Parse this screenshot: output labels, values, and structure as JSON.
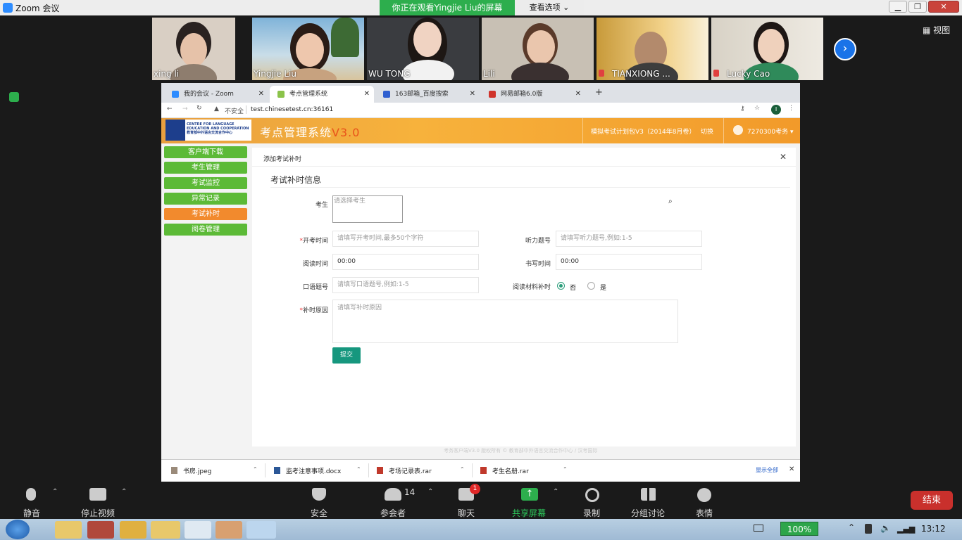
{
  "zoom": {
    "window_title": "Zoom 会议",
    "share_banner": "你正在观看Yingjie  Liu的屏幕",
    "view_options": "查看选项",
    "view_toggle": "视图",
    "participants": [
      {
        "name": "xing li",
        "muted": false
      },
      {
        "name": "Yingjie Liu",
        "muted": false
      },
      {
        "name": "WU TONG",
        "muted": false
      },
      {
        "name": "Lili",
        "muted": false
      },
      {
        "name": "TIANXIONG ...",
        "muted": true
      },
      {
        "name": "Lucky Cao",
        "muted": true
      }
    ],
    "toolbar": {
      "mute": "静音",
      "stop_video": "停止视频",
      "security": "安全",
      "participants": "参会者",
      "participants_count": "14",
      "chat": "聊天",
      "chat_badge": "1",
      "share_screen": "共享屏幕",
      "record": "录制",
      "breakout": "分组讨论",
      "reactions": "表情",
      "end": "结束"
    }
  },
  "browser": {
    "tabs": [
      {
        "title": "我的会议 - Zoom",
        "active": false
      },
      {
        "title": "考点管理系统",
        "active": true
      },
      {
        "title": "163邮箱_百度搜索",
        "active": false
      },
      {
        "title": "网易邮箱6.0版",
        "active": false
      }
    ],
    "new_tab": "+",
    "security_label": "不安全",
    "url": "test.chinesetest.cn:36161",
    "profile_initial": "I"
  },
  "site": {
    "logo_text": "CENTRE FOR LANGUAGE EDUCATION AND COOPERATION 教育部中外语言交流合作中心",
    "title": "考点管理系统",
    "version": "V3.0",
    "plan": "模拟考试计划包V3（2014年8月卷）",
    "switch": "切换",
    "user": "7270300考务",
    "nav": [
      {
        "label": "客户端下载",
        "active": false
      },
      {
        "label": "考生管理",
        "active": false
      },
      {
        "label": "考试监控",
        "active": false
      },
      {
        "label": "异常记录",
        "active": false
      },
      {
        "label": "考试补时",
        "active": true
      },
      {
        "label": "阅卷管理",
        "active": false
      }
    ],
    "footer": "考务客户端V3.0 版权所有 © 教育部中外语言交流合作中心 / 汉考国际"
  },
  "form": {
    "dialog_title": "添加考试补时",
    "section_title": "考试补时信息",
    "fields": {
      "candidate": {
        "label": "考生",
        "placeholder": "请选择考生"
      },
      "start_time": {
        "label": "开考时间",
        "placeholder": "请填写开考时间,最多50个字符"
      },
      "listening_no": {
        "label": "听力题号",
        "placeholder": "请填写听力题号,例如:1-5"
      },
      "reading_time": {
        "label": "阅读时间",
        "value": "00:00"
      },
      "writing_time": {
        "label": "书写时间",
        "value": "00:00"
      },
      "speaking_no": {
        "label": "口语题号",
        "placeholder": "请填写口语题号,例如:1-5"
      },
      "reading_material": {
        "label": "阅读材料补时",
        "options": [
          "否",
          "是"
        ],
        "selected": "否"
      },
      "reason": {
        "label": "补时原因",
        "placeholder": "请填写补时原因"
      }
    },
    "submit": "提交"
  },
  "downloads": {
    "items": [
      "书房.jpeg",
      "监考注意事项.docx",
      "考场记录表.rar",
      "考生名册.rar"
    ],
    "show_all": "显示全部"
  },
  "taskbar": {
    "battery": "100%",
    "time": "13:12"
  }
}
